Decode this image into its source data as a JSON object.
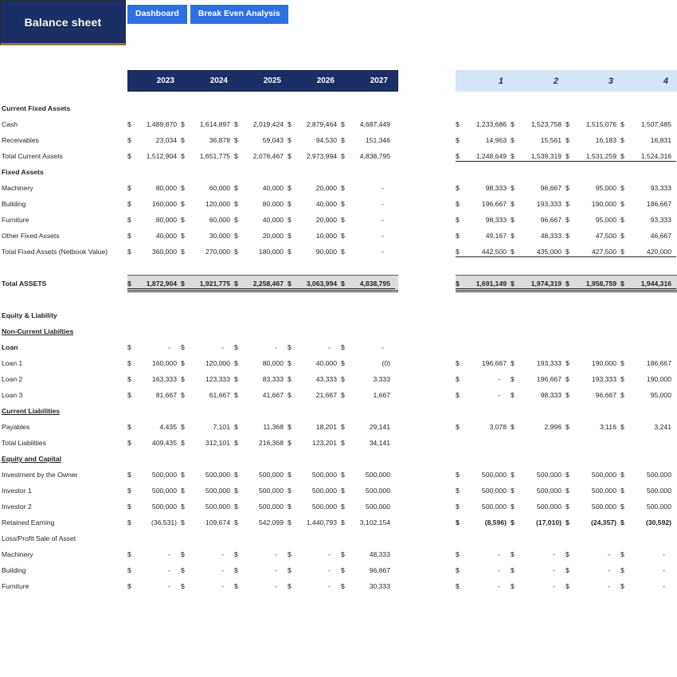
{
  "app": {
    "title": "Balance sheet",
    "tabs": [
      {
        "label": "Dashboard"
      },
      {
        "label": "Break Even  Analysis"
      }
    ],
    "colors": {
      "title_bg": "#1b2f66",
      "tab_bg": "#2f6fe4",
      "header_dark": "#1b2f66",
      "header_light": "#d6e4f7",
      "total_band": "#dcdcdc"
    }
  },
  "left_table": {
    "headers": [
      "2023",
      "2024",
      "2025",
      "2026",
      "2027"
    ],
    "currency_symbol": "$",
    "rows": [
      {
        "label": "Current Fixed Assets",
        "style": "section",
        "values": []
      },
      {
        "label": "Cash",
        "style": "normal",
        "values": [
          "1,489,870",
          "1,614,897",
          "2,019,424",
          "2,879,464",
          "4,687,449"
        ]
      },
      {
        "label": "Receivables",
        "style": "normal",
        "values": [
          "23,034",
          "36,878",
          "59,043",
          "94,530",
          "151,346"
        ]
      },
      {
        "label": "Total Current Assets",
        "style": "normal",
        "values": [
          "1,512,904",
          "1,651,775",
          "2,078,467",
          "2,973,994",
          "4,838,795"
        ]
      },
      {
        "label": "Fixed Assets",
        "style": "section",
        "values": []
      },
      {
        "label": "Machinery",
        "style": "normal",
        "values": [
          "80,000",
          "60,000",
          "40,000",
          "20,000",
          "-"
        ]
      },
      {
        "label": "Building",
        "style": "normal",
        "values": [
          "160,000",
          "120,000",
          "80,000",
          "40,000",
          "-"
        ]
      },
      {
        "label": "Furniture",
        "style": "normal",
        "values": [
          "80,000",
          "60,000",
          "40,000",
          "20,000",
          "-"
        ]
      },
      {
        "label": "Other Fixed Assets",
        "style": "normal",
        "values": [
          "40,000",
          "30,000",
          "20,000",
          "10,000",
          "-"
        ]
      },
      {
        "label": "Total Fixed Assets (Netbook Value)",
        "style": "normal",
        "values": [
          "360,000",
          "270,000",
          "180,000",
          "90,000",
          "-"
        ]
      },
      {
        "label": "",
        "style": "blank",
        "values": []
      },
      {
        "label": "Total ASSETS",
        "style": "total",
        "values": [
          "1,872,904",
          "1,921,775",
          "2,258,467",
          "3,063,994",
          "4,838,795"
        ]
      },
      {
        "label": "",
        "style": "blank",
        "values": []
      },
      {
        "label": "Equity & Liability",
        "style": "section",
        "values": []
      },
      {
        "label": "Non-Current Liabilties",
        "style": "subsection",
        "values": []
      },
      {
        "label": "Loan",
        "style": "section",
        "values": [
          "-",
          "-",
          "-",
          "-",
          "-"
        ]
      },
      {
        "label": "Loan 1",
        "style": "normal",
        "values": [
          "160,000",
          "120,000",
          "80,000",
          "40,000",
          "(0)"
        ]
      },
      {
        "label": "Loan 2",
        "style": "normal",
        "values": [
          "163,333",
          "123,333",
          "83,333",
          "43,333",
          "3,333"
        ]
      },
      {
        "label": "Loan 3",
        "style": "normal",
        "values": [
          "81,667",
          "61,667",
          "41,667",
          "21,667",
          "1,667"
        ]
      },
      {
        "label": "Current Liabilities",
        "style": "subsection",
        "values": []
      },
      {
        "label": "Payables",
        "style": "normal",
        "values": [
          "4,435",
          "7,101",
          "11,368",
          "18,201",
          "29,141"
        ]
      },
      {
        "label": "Total Liabilities",
        "style": "normal",
        "values": [
          "409,435",
          "312,101",
          "216,368",
          "123,201",
          "34,141"
        ]
      },
      {
        "label": "Equity and Capital",
        "style": "subsection",
        "values": []
      },
      {
        "label": "Investment by the Owner",
        "style": "normal",
        "values": [
          "500,000",
          "500,000",
          "500,000",
          "500,000",
          "500,000"
        ]
      },
      {
        "label": "Investor 1",
        "style": "normal",
        "values": [
          "500,000",
          "500,000",
          "500,000",
          "500,000",
          "500,000"
        ]
      },
      {
        "label": "Investor 2",
        "style": "normal",
        "values": [
          "500,000",
          "500,000",
          "500,000",
          "500,000",
          "500,000"
        ]
      },
      {
        "label": "Retained Earning",
        "style": "normal",
        "values": [
          "(36,531)",
          "109,674",
          "542,099",
          "1,440,793",
          "3,102,154"
        ]
      },
      {
        "label": "Loss/Profit Sale of Asset",
        "style": "normal",
        "values": []
      },
      {
        "label": "Machinery",
        "style": "normal",
        "values": [
          "-",
          "-",
          "-",
          "-",
          "48,333"
        ]
      },
      {
        "label": "Building",
        "style": "normal",
        "values": [
          "-",
          "-",
          "-",
          "-",
          "96,667"
        ]
      },
      {
        "label": "Furniture",
        "style": "normal",
        "values": [
          "-",
          "-",
          "-",
          "-",
          "30,333"
        ]
      }
    ]
  },
  "right_table": {
    "headers": [
      "1",
      "2",
      "3",
      "4"
    ],
    "currency_symbol": "$",
    "rows": [
      {
        "label": "Current Fixed Assets",
        "style": "section",
        "values": []
      },
      {
        "label": "Cash",
        "style": "normal",
        "values": [
          "1,233,686",
          "1,523,758",
          "1,515,076",
          "1,507,485"
        ]
      },
      {
        "label": "Receivables",
        "style": "normal",
        "values": [
          "14,963",
          "15,561",
          "16,183",
          "16,831"
        ]
      },
      {
        "label": "Total Current Assets",
        "style": "underlined",
        "values": [
          "1,248,649",
          "1,539,319",
          "1,531,259",
          "1,524,316"
        ]
      },
      {
        "label": "Fixed Assets",
        "style": "section",
        "values": []
      },
      {
        "label": "Machinery",
        "style": "normal",
        "values": [
          "98,333",
          "96,667",
          "95,000",
          "93,333"
        ]
      },
      {
        "label": "Building",
        "style": "normal",
        "values": [
          "196,667",
          "193,333",
          "190,000",
          "186,667"
        ]
      },
      {
        "label": "Furniture",
        "style": "normal",
        "values": [
          "98,333",
          "96,667",
          "95,000",
          "93,333"
        ]
      },
      {
        "label": "Other Fixed Assets",
        "style": "normal",
        "values": [
          "49,167",
          "48,333",
          "47,500",
          "46,667"
        ]
      },
      {
        "label": "Total Fixed Assets (Netbook Value)",
        "style": "underlined",
        "values": [
          "442,500",
          "435,000",
          "427,500",
          "420,000"
        ]
      },
      {
        "label": "",
        "style": "blank",
        "values": []
      },
      {
        "label": "Total ASSETS",
        "style": "total",
        "values": [
          "1,691,149",
          "1,974,319",
          "1,958,759",
          "1,944,316"
        ]
      },
      {
        "label": "",
        "style": "blank",
        "values": []
      },
      {
        "label": "Equity & Liability",
        "style": "blank",
        "values": []
      },
      {
        "label": "Non-Current Liabilties",
        "style": "blank",
        "values": []
      },
      {
        "label": "Loan",
        "style": "blank",
        "values": []
      },
      {
        "label": "Loan 1",
        "style": "normal",
        "values": [
          "196,667",
          "193,333",
          "190,000",
          "186,667"
        ]
      },
      {
        "label": "Loan 2",
        "style": "normal",
        "values": [
          "-",
          "196,667",
          "193,333",
          "190,000"
        ]
      },
      {
        "label": "Loan 3",
        "style": "normal",
        "values": [
          "-",
          "98,333",
          "96,667",
          "95,000"
        ]
      },
      {
        "label": "Current Liabilities",
        "style": "blank",
        "values": []
      },
      {
        "label": "Payables",
        "style": "normal",
        "values": [
          "3,078",
          "2,996",
          "3,116",
          "3,241"
        ]
      },
      {
        "label": "Total Liabilities",
        "style": "blank",
        "values": []
      },
      {
        "label": "Equity and Capital",
        "style": "blank",
        "values": []
      },
      {
        "label": "Investment by the Owner",
        "style": "normal",
        "values": [
          "500,000",
          "500,000",
          "500,000",
          "500,000"
        ]
      },
      {
        "label": "Investor 1",
        "style": "normal",
        "values": [
          "500,000",
          "500,000",
          "500,000",
          "500,000"
        ]
      },
      {
        "label": "Investor 2",
        "style": "normal",
        "values": [
          "500,000",
          "500,000",
          "500,000",
          "500,000"
        ]
      },
      {
        "label": "Retained Earning",
        "style": "bold",
        "values": [
          "(8,596)",
          "(17,010)",
          "(24,357)",
          "(30,592)"
        ]
      },
      {
        "label": "Loss/Profit Sale of Asset",
        "style": "blank",
        "values": []
      },
      {
        "label": "Machinery",
        "style": "normal",
        "values": [
          "-",
          "-",
          "-",
          "-"
        ]
      },
      {
        "label": "Building",
        "style": "normal",
        "values": [
          "-",
          "-",
          "-",
          "-"
        ]
      },
      {
        "label": "Furniture",
        "style": "normal",
        "values": [
          "-",
          "-",
          "-",
          "-"
        ]
      }
    ]
  }
}
